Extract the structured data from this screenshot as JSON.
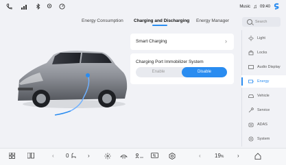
{
  "status_bar": {
    "music_label": "Music",
    "time": "09:40",
    "accent_color": "#2a8cf0"
  },
  "tabs": [
    {
      "label": "Energy Consumption"
    },
    {
      "label": "Charging and Discharging"
    },
    {
      "label": "Energy Manager"
    }
  ],
  "active_tab": "Charging and Discharging",
  "search": {
    "placeholder": "Search"
  },
  "main": {
    "smart_charging": {
      "label": "Smart Charging"
    },
    "immobilizer": {
      "label": "Charging Port Immobilizer System",
      "options": [
        "Enable",
        "Disable"
      ],
      "selected": "Disable"
    }
  },
  "sidebar": {
    "items": [
      {
        "label": "Light",
        "icon": "light-icon"
      },
      {
        "label": "Locks",
        "icon": "lock-icon"
      },
      {
        "label": "Audio Display",
        "icon": "audio-display-icon"
      },
      {
        "label": "Energy",
        "icon": "energy-icon"
      },
      {
        "label": "Vehicle",
        "icon": "vehicle-icon"
      },
      {
        "label": "Service",
        "icon": "service-icon"
      },
      {
        "label": "ADAS",
        "icon": "adas-icon"
      },
      {
        "label": "System",
        "icon": "system-icon"
      }
    ],
    "active": "Energy"
  },
  "dock": {
    "left_temp_value": "0",
    "right_temp_value": "19",
    "temp_unit": "%"
  }
}
